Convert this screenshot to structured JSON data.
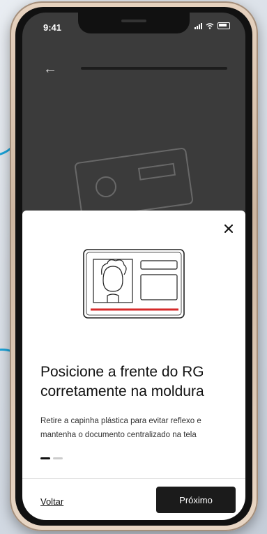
{
  "status_bar": {
    "time": "9:41"
  },
  "modal": {
    "title": "Posicione a frente do RG corretamente na moldura",
    "description": "Retire a capinha plástica para evitar reflexo e mantenha o documento centralizado na tela",
    "back_label": "Voltar",
    "next_label": "Próximo",
    "pager": {
      "current": 1,
      "total": 2
    }
  },
  "icons": [
    "back-arrow-icon",
    "close-icon",
    "signal-icon",
    "wifi-icon",
    "battery-icon",
    "id-card-illustration"
  ],
  "colors": {
    "primary_button": "#1b1b1b",
    "accent_stripe": "#d62a2a",
    "deco_line": "#1aa3d9"
  }
}
